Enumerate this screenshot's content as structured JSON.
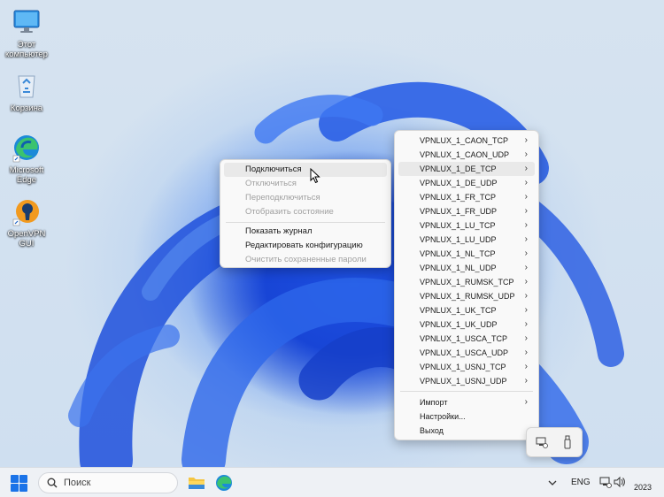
{
  "desktop": {
    "icons": [
      {
        "label": "Этот компьютер"
      },
      {
        "label": "Корзина"
      },
      {
        "label": "Microsoft Edge"
      },
      {
        "label": "OpenVPN GUI"
      }
    ]
  },
  "context_menu": {
    "items": [
      {
        "label": "Подключиться",
        "enabled": true
      },
      {
        "label": "Отключиться",
        "enabled": false
      },
      {
        "label": "Переподключиться",
        "enabled": false
      },
      {
        "label": "Отобразить состояние",
        "enabled": false
      },
      {
        "label": "Показать журнал",
        "enabled": true
      },
      {
        "label": "Редактировать конфигурацию",
        "enabled": true
      },
      {
        "label": "Очистить сохраненные пароли",
        "enabled": false
      }
    ]
  },
  "profile_menu": {
    "profiles": [
      "VPNLUX_1_CAON_TCP",
      "VPNLUX_1_CAON_UDP",
      "VPNLUX_1_DE_TCP",
      "VPNLUX_1_DE_UDP",
      "VPNLUX_1_FR_TCP",
      "VPNLUX_1_FR_UDP",
      "VPNLUX_1_LU_TCP",
      "VPNLUX_1_LU_UDP",
      "VPNLUX_1_NL_TCP",
      "VPNLUX_1_NL_UDP",
      "VPNLUX_1_RUMSK_TCP",
      "VPNLUX_1_RUMSK_UDP",
      "VPNLUX_1_UK_TCP",
      "VPNLUX_1_UK_UDP",
      "VPNLUX_1_USCA_TCP",
      "VPNLUX_1_USCA_UDP",
      "VPNLUX_1_USNJ_TCP",
      "VPNLUX_1_USNJ_UDP"
    ],
    "highlighted_profile": "VPNLUX_1_DE_TCP",
    "actions": [
      "Импорт",
      "Настройки...",
      "Выход"
    ]
  },
  "taskbar": {
    "search_placeholder": "Поиск",
    "language": "ENG",
    "year": "2023"
  }
}
